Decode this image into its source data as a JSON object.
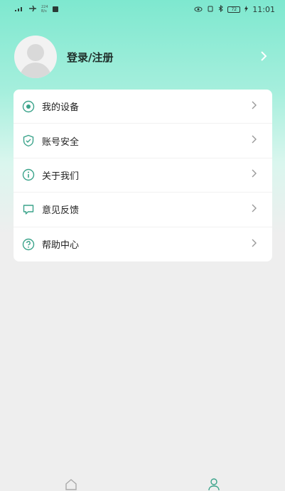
{
  "status_bar": {
    "carrier_small": [
      "224",
      "B/s"
    ],
    "time": "11:01",
    "battery": "72"
  },
  "profile": {
    "login_label": "登录/注册"
  },
  "menu": [
    {
      "label": "我的设备",
      "icon": "device-icon"
    },
    {
      "label": "账号安全",
      "icon": "shield-icon"
    },
    {
      "label": "关于我们",
      "icon": "info-icon"
    },
    {
      "label": "意见反馈",
      "icon": "feedback-icon"
    },
    {
      "label": "帮助中心",
      "icon": "help-icon"
    }
  ],
  "bottom_nav": [
    {
      "icon": "home-icon",
      "active": false
    },
    {
      "icon": "user-icon",
      "active": true
    }
  ],
  "colors": {
    "accent": "#7ee8cf",
    "icon_teal": "#3aa38a"
  }
}
